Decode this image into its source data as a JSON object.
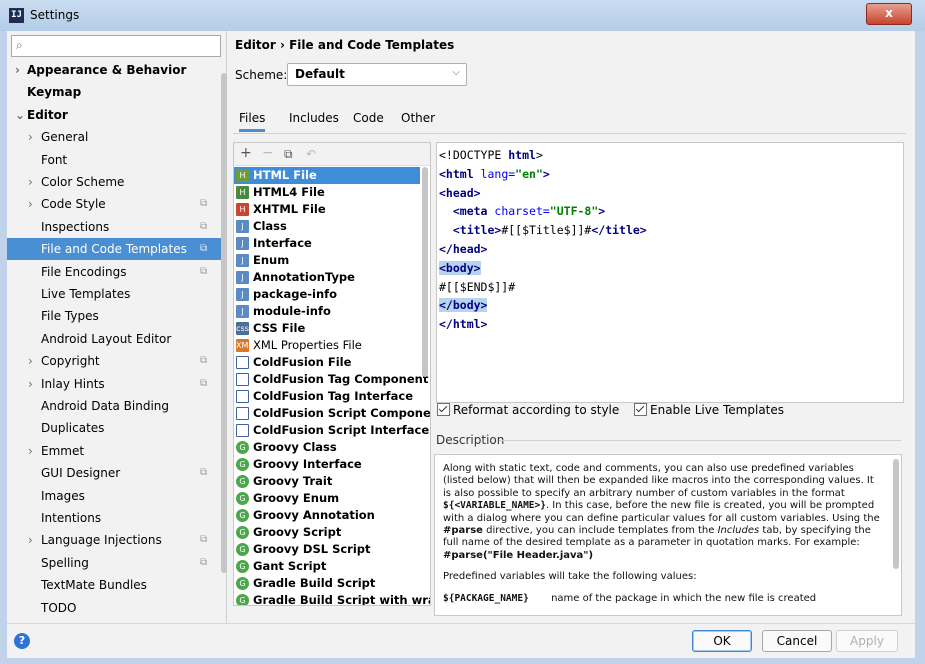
{
  "window": {
    "title": "Settings",
    "close_label": "x",
    "logo_text": "IJ"
  },
  "sidebar": {
    "search_placeholder": "",
    "items": [
      {
        "label": "Appearance & Behavior",
        "arrow": "›",
        "bold": true
      },
      {
        "label": "Keymap",
        "arrow": "",
        "bold": true
      },
      {
        "label": "Editor",
        "arrow": "⌄",
        "bold": true
      },
      {
        "label": "General",
        "arrow": "›"
      },
      {
        "label": "Font",
        "arrow": ""
      },
      {
        "label": "Color Scheme",
        "arrow": "›"
      },
      {
        "label": "Code Style",
        "arrow": "›",
        "badge": true
      },
      {
        "label": "Inspections",
        "arrow": "",
        "badge": true
      },
      {
        "label": "File and Code Templates",
        "arrow": "",
        "badge": true,
        "selected": true
      },
      {
        "label": "File Encodings",
        "arrow": "",
        "badge": true
      },
      {
        "label": "Live Templates",
        "arrow": ""
      },
      {
        "label": "File Types",
        "arrow": ""
      },
      {
        "label": "Android Layout Editor",
        "arrow": ""
      },
      {
        "label": "Copyright",
        "arrow": "›",
        "badge": true
      },
      {
        "label": "Inlay Hints",
        "arrow": "›",
        "badge": true
      },
      {
        "label": "Android Data Binding",
        "arrow": ""
      },
      {
        "label": "Duplicates",
        "arrow": ""
      },
      {
        "label": "Emmet",
        "arrow": "›"
      },
      {
        "label": "GUI Designer",
        "arrow": "",
        "badge": true
      },
      {
        "label": "Images",
        "arrow": ""
      },
      {
        "label": "Intentions",
        "arrow": ""
      },
      {
        "label": "Language Injections",
        "arrow": "›",
        "badge": true
      },
      {
        "label": "Spelling",
        "arrow": "",
        "badge": true
      },
      {
        "label": "TextMate Bundles",
        "arrow": ""
      },
      {
        "label": "TODO",
        "arrow": ""
      }
    ]
  },
  "main": {
    "breadcrumb": "Editor  ›  File and Code Templates",
    "scheme_label": "Scheme:",
    "scheme_value": "Default",
    "tabs": [
      "Files",
      "Includes",
      "Code",
      "Other"
    ],
    "templates": [
      {
        "name": "HTML File",
        "icon": "file",
        "selected": true
      },
      {
        "name": "HTML4 File",
        "icon": "html4"
      },
      {
        "name": "XHTML File",
        "icon": "xhtml"
      },
      {
        "name": "Class",
        "icon": "java"
      },
      {
        "name": "Interface",
        "icon": "java"
      },
      {
        "name": "Enum",
        "icon": "java"
      },
      {
        "name": "AnnotationType",
        "icon": "java"
      },
      {
        "name": "package-info",
        "icon": "java"
      },
      {
        "name": "module-info",
        "icon": "java"
      },
      {
        "name": "CSS File",
        "icon": "css"
      },
      {
        "name": "XML Properties File",
        "icon": "xml",
        "plain": true
      },
      {
        "name": "ColdFusion File",
        "icon": "cf"
      },
      {
        "name": "ColdFusion Tag Component",
        "icon": "cf"
      },
      {
        "name": "ColdFusion Tag Interface",
        "icon": "cf"
      },
      {
        "name": "ColdFusion Script Component",
        "icon": "cf"
      },
      {
        "name": "ColdFusion Script Interface",
        "icon": "cf"
      },
      {
        "name": "Groovy Class",
        "icon": "groovy"
      },
      {
        "name": "Groovy Interface",
        "icon": "groovy"
      },
      {
        "name": "Groovy Trait",
        "icon": "groovy"
      },
      {
        "name": "Groovy Enum",
        "icon": "groovy"
      },
      {
        "name": "Groovy Annotation",
        "icon": "groovy"
      },
      {
        "name": "Groovy Script",
        "icon": "groovy"
      },
      {
        "name": "Groovy DSL Script",
        "icon": "groovy"
      },
      {
        "name": "Gant Script",
        "icon": "groovy"
      },
      {
        "name": "Gradle Build Script",
        "icon": "groovy"
      },
      {
        "name": "Gradle Build Script with wrappe",
        "icon": "groovy"
      }
    ],
    "code_lines": [
      [
        {
          "t": "<!DOCTYPE ",
          "c": ""
        },
        {
          "t": "html",
          "c": "tag"
        },
        {
          "t": ">",
          "c": ""
        }
      ],
      [
        {
          "t": "<html ",
          "c": "tag"
        },
        {
          "t": "lang=",
          "c": "attr"
        },
        {
          "t": "\"en\"",
          "c": "str"
        },
        {
          "t": ">",
          "c": "tag"
        }
      ],
      [
        {
          "t": "<head>",
          "c": "tag"
        }
      ],
      [
        {
          "t": "  ",
          "c": ""
        },
        {
          "t": "<meta ",
          "c": "tag"
        },
        {
          "t": "charset=",
          "c": "attr"
        },
        {
          "t": "\"UTF-8\"",
          "c": "str"
        },
        {
          "t": ">",
          "c": "tag"
        }
      ],
      [
        {
          "t": "  ",
          "c": ""
        },
        {
          "t": "<title>",
          "c": "tag"
        },
        {
          "t": "#[[$Title$]]#",
          "c": ""
        },
        {
          "t": "</title>",
          "c": "tag"
        }
      ],
      [
        {
          "t": "</head>",
          "c": "tag"
        }
      ],
      [
        {
          "t": "<body>",
          "c": "tag hl"
        }
      ],
      [
        {
          "t": "#[[$END$]]#",
          "c": ""
        }
      ],
      [
        {
          "t": "</body>",
          "c": "tag hl"
        }
      ],
      [
        {
          "t": "</html>",
          "c": "tag"
        }
      ]
    ],
    "reformat_label": "Reformat according to style",
    "live_templates_label": "Enable Live Templates",
    "description_header": "Description",
    "description": {
      "p1a": "Along with static text, code and comments, you can also use predefined variables (listed below) that will then be expanded like macros into the corresponding values. It is also possible to specify an arbitrary number of custom variables in the format ",
      "p1code": "${<VARIABLE_NAME>}",
      "p1b": ". In this case, before the new file is created, you will be prompted with a dialog where you can define particular values for all custom variables. Using the ",
      "p1parse": "#parse",
      "p1c": " directive, you can include templates from the ",
      "p1includes": "Includes",
      "p1d": " tab, by specifying the full name of the desired template as a parameter in quotation marks. For example:",
      "p1example": "#parse(\"File Header.java\")",
      "p2": "Predefined variables will take the following values:",
      "p3code": "${PACKAGE_NAME}",
      "p3": "name of the package in which the new file is created"
    }
  },
  "footer": {
    "ok": "OK",
    "cancel": "Cancel",
    "apply": "Apply",
    "help": "?"
  }
}
